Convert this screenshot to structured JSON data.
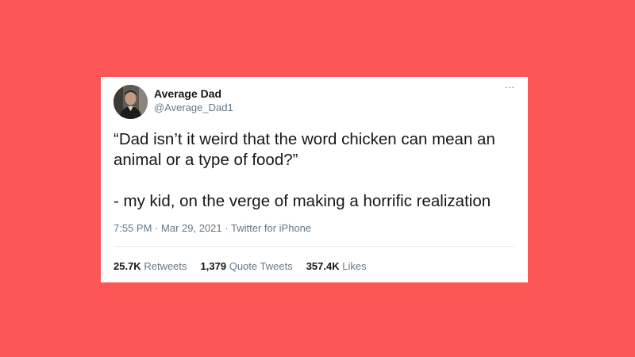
{
  "tweet": {
    "author_name": "Average Dad",
    "author_handle": "@Average_Dad1",
    "more_label": "···",
    "text_line1": "“Dad isn’t it weird that the word chicken can mean an animal or a type of food?”",
    "text_line2": "- my kid, on the verge of making a horrific realization",
    "time": "7:55 PM",
    "date": "Mar 29, 2021",
    "source": "Twitter for iPhone",
    "separator": "·"
  },
  "stats": [
    {
      "count": "25.7K",
      "label": "Retweets"
    },
    {
      "count": "1,379",
      "label": "Quote Tweets"
    },
    {
      "count": "357.4K",
      "label": "Likes"
    }
  ],
  "colors": {
    "background": "#fd5657",
    "card": "#ffffff",
    "text": "#14171a",
    "secondary_text": "#657786"
  }
}
